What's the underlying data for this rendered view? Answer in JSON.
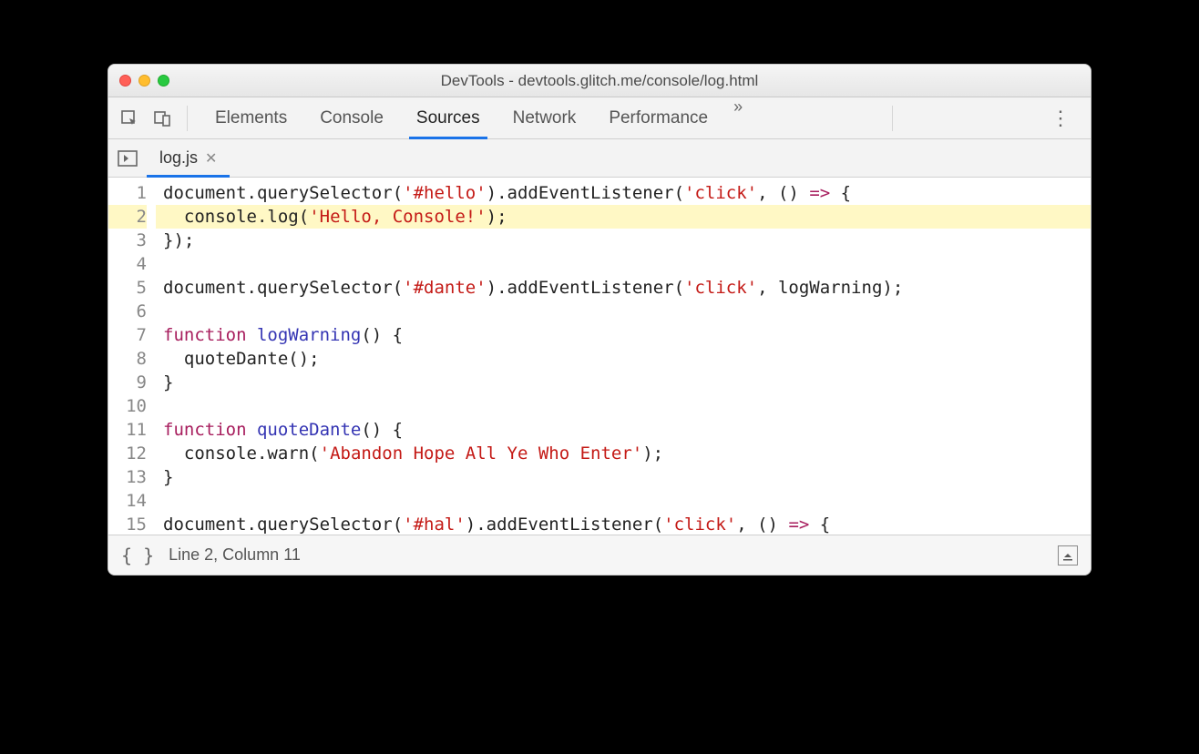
{
  "window": {
    "title": "DevTools - devtools.glitch.me/console/log.html"
  },
  "toolbar": {
    "tabs": [
      "Elements",
      "Console",
      "Sources",
      "Network",
      "Performance"
    ],
    "activeTab": "Sources",
    "overflow": "»"
  },
  "file": {
    "name": "log.js"
  },
  "code": {
    "highlightedLine": 2,
    "lines": [
      {
        "n": 1,
        "tokens": [
          {
            "t": "document",
            "c": "p"
          },
          {
            "t": ".",
            "c": "p"
          },
          {
            "t": "querySelector",
            "c": "p"
          },
          {
            "t": "(",
            "c": "p"
          },
          {
            "t": "'#hello'",
            "c": "s"
          },
          {
            "t": ").",
            "c": "p"
          },
          {
            "t": "addEventListener",
            "c": "p"
          },
          {
            "t": "(",
            "c": "p"
          },
          {
            "t": "'click'",
            "c": "s"
          },
          {
            "t": ", () ",
            "c": "p"
          },
          {
            "t": "=>",
            "c": "k"
          },
          {
            "t": " {",
            "c": "p"
          }
        ]
      },
      {
        "n": 2,
        "tokens": [
          {
            "t": "  console",
            "c": "p"
          },
          {
            "t": ".",
            "c": "p"
          },
          {
            "t": "log",
            "c": "p"
          },
          {
            "t": "(",
            "c": "p"
          },
          {
            "t": "'Hello, Console!'",
            "c": "s"
          },
          {
            "t": ");",
            "c": "p"
          }
        ]
      },
      {
        "n": 3,
        "tokens": [
          {
            "t": "});",
            "c": "p"
          }
        ]
      },
      {
        "n": 4,
        "tokens": []
      },
      {
        "n": 5,
        "tokens": [
          {
            "t": "document",
            "c": "p"
          },
          {
            "t": ".",
            "c": "p"
          },
          {
            "t": "querySelector",
            "c": "p"
          },
          {
            "t": "(",
            "c": "p"
          },
          {
            "t": "'#dante'",
            "c": "s"
          },
          {
            "t": ").",
            "c": "p"
          },
          {
            "t": "addEventListener",
            "c": "p"
          },
          {
            "t": "(",
            "c": "p"
          },
          {
            "t": "'click'",
            "c": "s"
          },
          {
            "t": ", logWarning);",
            "c": "p"
          }
        ]
      },
      {
        "n": 6,
        "tokens": []
      },
      {
        "n": 7,
        "tokens": [
          {
            "t": "function",
            "c": "k"
          },
          {
            "t": " ",
            "c": "p"
          },
          {
            "t": "logWarning",
            "c": "def"
          },
          {
            "t": "() {",
            "c": "p"
          }
        ]
      },
      {
        "n": 8,
        "tokens": [
          {
            "t": "  quoteDante();",
            "c": "p"
          }
        ]
      },
      {
        "n": 9,
        "tokens": [
          {
            "t": "}",
            "c": "p"
          }
        ]
      },
      {
        "n": 10,
        "tokens": []
      },
      {
        "n": 11,
        "tokens": [
          {
            "t": "function",
            "c": "k"
          },
          {
            "t": " ",
            "c": "p"
          },
          {
            "t": "quoteDante",
            "c": "def"
          },
          {
            "t": "() {",
            "c": "p"
          }
        ]
      },
      {
        "n": 12,
        "tokens": [
          {
            "t": "  console",
            "c": "p"
          },
          {
            "t": ".",
            "c": "p"
          },
          {
            "t": "warn",
            "c": "p"
          },
          {
            "t": "(",
            "c": "p"
          },
          {
            "t": "'Abandon Hope All Ye Who Enter'",
            "c": "s"
          },
          {
            "t": ");",
            "c": "p"
          }
        ]
      },
      {
        "n": 13,
        "tokens": [
          {
            "t": "}",
            "c": "p"
          }
        ]
      },
      {
        "n": 14,
        "tokens": []
      },
      {
        "n": 15,
        "tokens": [
          {
            "t": "document",
            "c": "p"
          },
          {
            "t": ".",
            "c": "p"
          },
          {
            "t": "querySelector",
            "c": "p"
          },
          {
            "t": "(",
            "c": "p"
          },
          {
            "t": "'#hal'",
            "c": "s"
          },
          {
            "t": ").",
            "c": "p"
          },
          {
            "t": "addEventListener",
            "c": "p"
          },
          {
            "t": "(",
            "c": "p"
          },
          {
            "t": "'click'",
            "c": "s"
          },
          {
            "t": ", () ",
            "c": "p"
          },
          {
            "t": "=>",
            "c": "k"
          },
          {
            "t": " {",
            "c": "p"
          }
        ]
      }
    ]
  },
  "status": {
    "cursor": "Line 2, Column 11",
    "pretty": "{ }"
  }
}
